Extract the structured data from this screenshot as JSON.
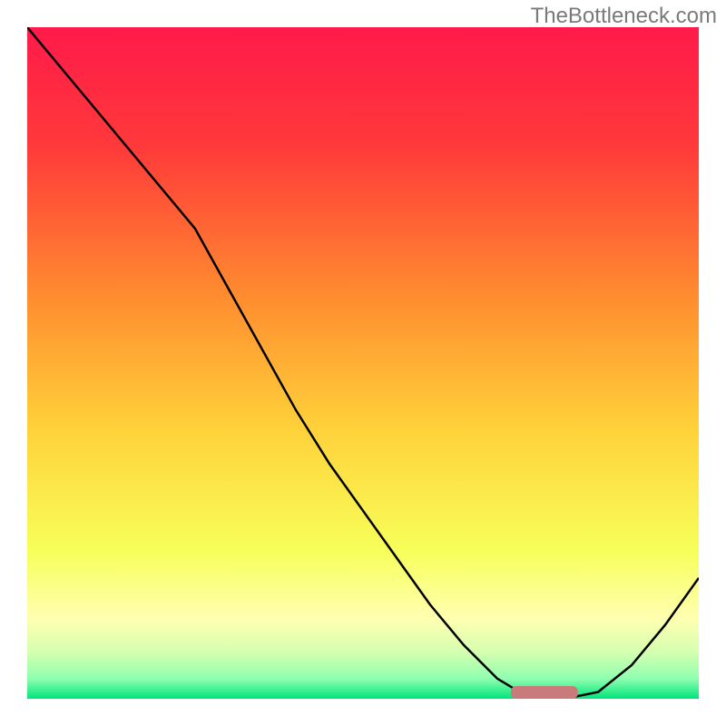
{
  "watermark": "TheBottleneck.com",
  "chart_data": {
    "type": "line",
    "title": "",
    "xlabel": "",
    "ylabel": "",
    "x": [
      0.0,
      0.05,
      0.1,
      0.15,
      0.2,
      0.25,
      0.3,
      0.35,
      0.4,
      0.45,
      0.5,
      0.55,
      0.6,
      0.65,
      0.7,
      0.75,
      0.8,
      0.85,
      0.9,
      0.95,
      1.0
    ],
    "y": [
      1.0,
      0.94,
      0.88,
      0.82,
      0.76,
      0.7,
      0.61,
      0.52,
      0.43,
      0.35,
      0.28,
      0.21,
      0.14,
      0.08,
      0.03,
      0.0,
      0.0,
      0.01,
      0.05,
      0.11,
      0.18
    ],
    "optimum_band": {
      "x_start": 0.72,
      "x_end": 0.82
    },
    "gradient_stops": [
      {
        "offset": 0.0,
        "color": "#ff1a4a"
      },
      {
        "offset": 0.18,
        "color": "#ff3a3a"
      },
      {
        "offset": 0.4,
        "color": "#ff8c2f"
      },
      {
        "offset": 0.6,
        "color": "#ffd23a"
      },
      {
        "offset": 0.78,
        "color": "#f7ff5a"
      },
      {
        "offset": 0.88,
        "color": "#ffffb0"
      },
      {
        "offset": 0.93,
        "color": "#d6ffb0"
      },
      {
        "offset": 0.97,
        "color": "#8fffb0"
      },
      {
        "offset": 1.0,
        "color": "#00e57a"
      }
    ],
    "xlim": [
      0,
      1
    ],
    "ylim": [
      0,
      1
    ]
  },
  "colors": {
    "line": "#000000",
    "marker": "#c97b7b",
    "watermark": "#7a7a7a"
  }
}
